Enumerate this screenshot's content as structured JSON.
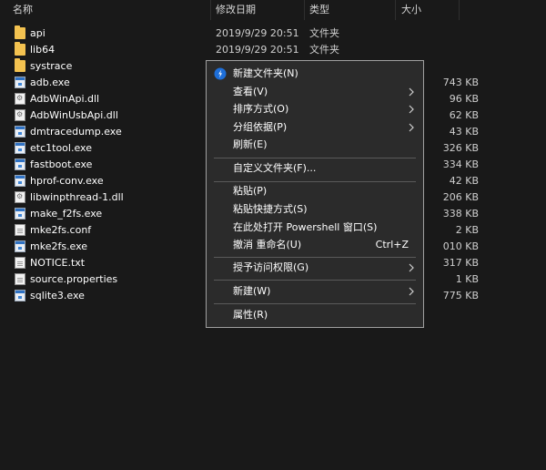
{
  "columns": {
    "name": "名称",
    "date": "修改日期",
    "type": "类型",
    "size": "大小"
  },
  "files": [
    {
      "name": "api",
      "date": "2019/9/29 20:51",
      "type": "文件夹",
      "size": "",
      "icon": "folder-icon"
    },
    {
      "name": "lib64",
      "date": "2019/9/29 20:51",
      "type": "文件夹",
      "size": "",
      "icon": "folder-icon"
    },
    {
      "name": "systrace",
      "date": "",
      "type": "",
      "size": "",
      "icon": "folder-icon"
    },
    {
      "name": "adb.exe",
      "date": "",
      "type": "",
      "size": "743 KB",
      "icon": "exe-icon"
    },
    {
      "name": "AdbWinApi.dll",
      "date": "",
      "type": "",
      "size": "96 KB",
      "icon": "dll-icon"
    },
    {
      "name": "AdbWinUsbApi.dll",
      "date": "",
      "type": "",
      "size": "62 KB",
      "icon": "dll-icon"
    },
    {
      "name": "dmtracedump.exe",
      "date": "",
      "type": "",
      "size": "43 KB",
      "icon": "exe-icon"
    },
    {
      "name": "etc1tool.exe",
      "date": "",
      "type": "",
      "size": "326 KB",
      "icon": "exe-icon"
    },
    {
      "name": "fastboot.exe",
      "date": "",
      "type": "",
      "size": "334 KB",
      "icon": "exe-icon"
    },
    {
      "name": "hprof-conv.exe",
      "date": "",
      "type": "",
      "size": "42 KB",
      "icon": "exe-icon"
    },
    {
      "name": "libwinpthread-1.dll",
      "date": "",
      "type": "",
      "size": "206 KB",
      "icon": "dll-icon"
    },
    {
      "name": "make_f2fs.exe",
      "date": "",
      "type": "",
      "size": "338 KB",
      "icon": "exe-icon"
    },
    {
      "name": "mke2fs.conf",
      "date": "",
      "type": "",
      "size": "2 KB",
      "icon": "doc-icon"
    },
    {
      "name": "mke2fs.exe",
      "date": "",
      "type": "",
      "size": "010 KB",
      "icon": "exe-icon"
    },
    {
      "name": "NOTICE.txt",
      "date": "",
      "type": "",
      "size": "317 KB",
      "icon": "doc-icon"
    },
    {
      "name": "source.properties",
      "date": "",
      "type": "",
      "size": "1 KB",
      "icon": "doc-icon"
    },
    {
      "name": "sqlite3.exe",
      "date": "",
      "type": "",
      "size": "775 KB",
      "icon": "exe-icon"
    }
  ],
  "context_menu": {
    "new_folder": "新建文件夹(N)",
    "view": "查看(V)",
    "sort_by": "排序方式(O)",
    "group_by": "分组依据(P)",
    "refresh": "刷新(E)",
    "customize_folder": "自定义文件夹(F)...",
    "paste": "粘贴(P)",
    "paste_shortcut": "粘贴快捷方式(S)",
    "open_powershell": "在此处打开 Powershell 窗口(S)",
    "undo_rename": "撤消 重命名(U)",
    "undo_shortcut": "Ctrl+Z",
    "give_access": "授予访问权限(G)",
    "new": "新建(W)",
    "properties": "属性(R)"
  }
}
